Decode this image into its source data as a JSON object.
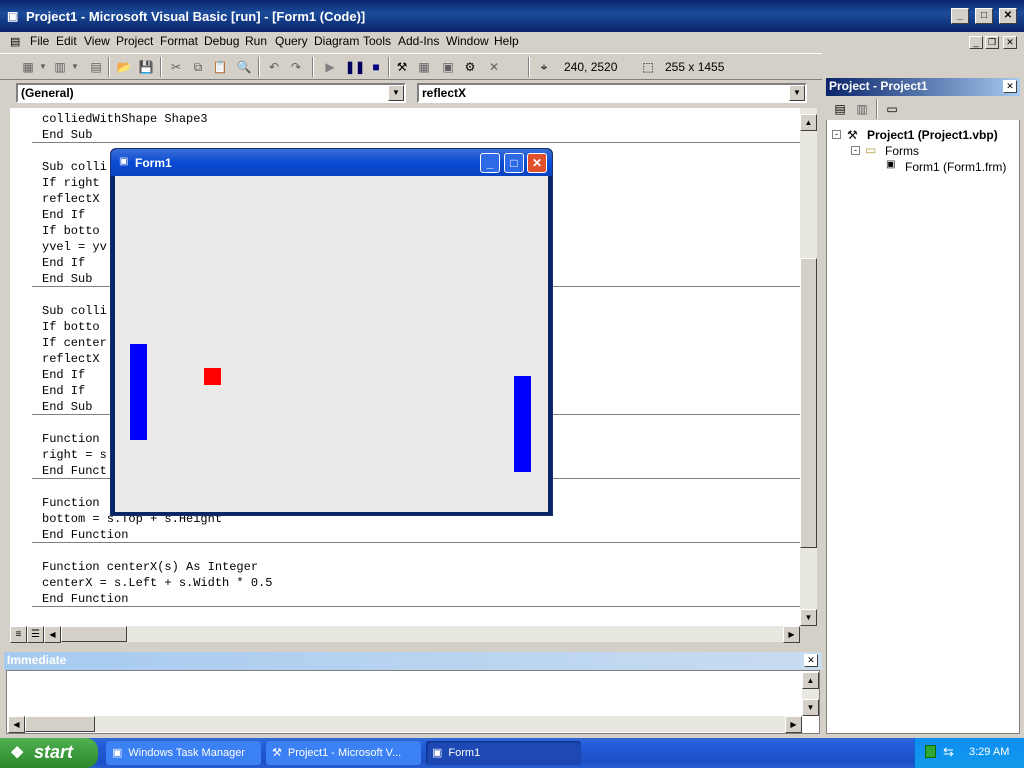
{
  "window": {
    "title": "Project1 - Microsoft Visual Basic [run] - [Form1 (Code)]"
  },
  "menu": [
    "File",
    "Edit",
    "View",
    "Project",
    "Format",
    "Debug",
    "Run",
    "Query",
    "Diagram",
    "Tools",
    "Add-Ins",
    "Window",
    "Help"
  ],
  "toolbar": {
    "position": "240, 2520",
    "size": "255 x 1455"
  },
  "code": {
    "object_combo": "(General)",
    "procedure_combo": "reflectX",
    "lines": [
      "colliedWithShape Shape3",
      "End Sub",
      "",
      "Sub colli",
      "If right",
      "reflectX",
      "End If",
      "If botto",
      "yvel = yv",
      "End If",
      "End Sub",
      "",
      "Sub colli",
      "If botto",
      "If center",
      "reflectX",
      "End If",
      "End If",
      "End Sub",
      "",
      "Function",
      "right = s",
      "End Funct",
      "",
      "Function",
      "bottom = s.Top + s.Height",
      "End Function",
      "",
      "Function centerX(s) As Integer",
      "centerX = s.Left + s.Width * 0.5",
      "End Function"
    ]
  },
  "form1": {
    "title": "Form1",
    "paddle_color": "#0000ff",
    "ball_color": "#ff0000"
  },
  "project_pane": {
    "title": "Project - Project1",
    "root": "Project1 (Project1.vbp)",
    "folder": "Forms",
    "item": "Form1 (Form1.frm)"
  },
  "immediate": {
    "title": "Immediate"
  },
  "taskbar": {
    "start": "start",
    "tasks": [
      "Windows Task Manager",
      "Project1 - Microsoft V...",
      "Form1"
    ],
    "clock": "3:29 AM"
  }
}
